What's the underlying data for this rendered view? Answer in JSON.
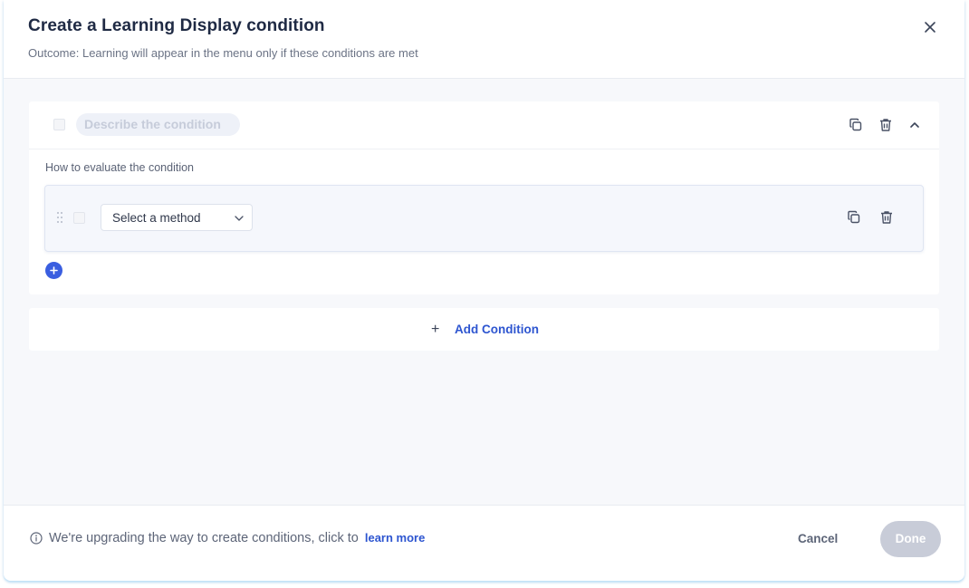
{
  "dialog": {
    "title": "Create a Learning Display condition",
    "subtitle": "Outcome: Learning will appear in the menu only if these conditions are met"
  },
  "condition": {
    "description_placeholder": "Describe the condition",
    "evaluate_label": "How to evaluate the condition",
    "method_select": {
      "selected": "Select a method"
    }
  },
  "add_condition": {
    "plus": "+",
    "label": "Add Condition"
  },
  "footer": {
    "info_text": "We're upgrading the way to create conditions, click to",
    "learn_more": "learn more",
    "cancel": "Cancel",
    "done": "Done"
  },
  "colors": {
    "accent": "#2d55d0",
    "add_circle": "#3a5ee0",
    "done_disabled": "#c8ccd8",
    "background": "#f7f8fb"
  },
  "icons": {
    "close": "close-icon",
    "copy": "copy-icon",
    "trash": "trash-icon",
    "collapse": "chevron-up-icon",
    "dropdown": "chevron-down-icon",
    "drag": "drag-handle-icon",
    "add": "plus-icon",
    "info": "info-icon"
  }
}
